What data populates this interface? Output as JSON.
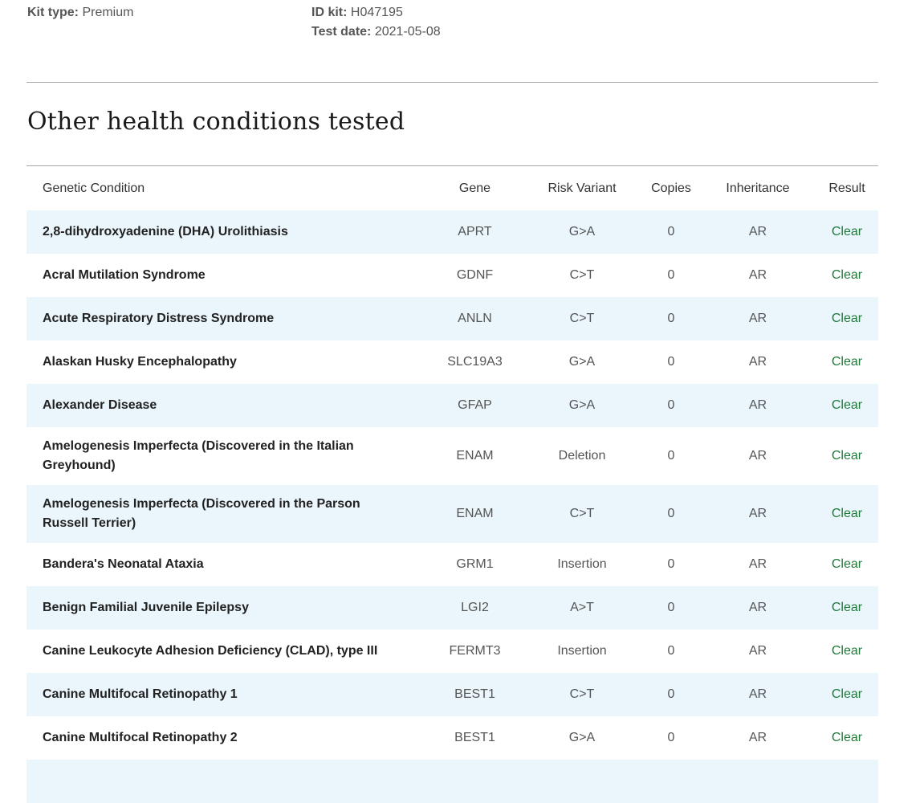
{
  "kit": {
    "type_label": "Kit type:",
    "type_value": "Premium",
    "id_label": "ID kit:",
    "id_value": "H047195",
    "date_label": "Test date:",
    "date_value": "2021-05-08"
  },
  "section": {
    "title": "Other health conditions tested"
  },
  "table": {
    "headers": {
      "condition": "Genetic Condition",
      "gene": "Gene",
      "risk": "Risk Variant",
      "copies": "Copies",
      "inheritance": "Inheritance",
      "result": "Result"
    },
    "rows": [
      {
        "condition": "2,8-dihydroxyadenine (DHA) Urolithiasis",
        "gene": "APRT",
        "risk": "G>A",
        "copies": "0",
        "inheritance": "AR",
        "result": "Clear"
      },
      {
        "condition": "Acral Mutilation Syndrome",
        "gene": "GDNF",
        "risk": "C>T",
        "copies": "0",
        "inheritance": "AR",
        "result": "Clear"
      },
      {
        "condition": "Acute Respiratory Distress Syndrome",
        "gene": "ANLN",
        "risk": "C>T",
        "copies": "0",
        "inheritance": "AR",
        "result": "Clear"
      },
      {
        "condition": "Alaskan Husky Encephalopathy",
        "gene": "SLC19A3",
        "risk": "G>A",
        "copies": "0",
        "inheritance": "AR",
        "result": "Clear"
      },
      {
        "condition": "Alexander Disease",
        "gene": "GFAP",
        "risk": "G>A",
        "copies": "0",
        "inheritance": "AR",
        "result": "Clear"
      },
      {
        "condition": "Amelogenesis Imperfecta (Discovered in the Italian Greyhound)",
        "gene": "ENAM",
        "risk": "Deletion",
        "copies": "0",
        "inheritance": "AR",
        "result": "Clear"
      },
      {
        "condition": "Amelogenesis Imperfecta (Discovered in the Parson Russell Terrier)",
        "gene": "ENAM",
        "risk": "C>T",
        "copies": "0",
        "inheritance": "AR",
        "result": "Clear"
      },
      {
        "condition": "Bandera's Neonatal Ataxia",
        "gene": "GRM1",
        "risk": "Insertion",
        "copies": "0",
        "inheritance": "AR",
        "result": "Clear"
      },
      {
        "condition": "Benign Familial Juvenile Epilepsy",
        "gene": "LGI2",
        "risk": "A>T",
        "copies": "0",
        "inheritance": "AR",
        "result": "Clear"
      },
      {
        "condition": "Canine Leukocyte Adhesion Deficiency (CLAD), type III",
        "gene": "FERMT3",
        "risk": "Insertion",
        "copies": "0",
        "inheritance": "AR",
        "result": "Clear"
      },
      {
        "condition": "Canine Multifocal Retinopathy 1",
        "gene": "BEST1",
        "risk": "C>T",
        "copies": "0",
        "inheritance": "AR",
        "result": "Clear"
      },
      {
        "condition": "Canine Multifocal Retinopathy 2",
        "gene": "BEST1",
        "risk": "G>A",
        "copies": "0",
        "inheritance": "AR",
        "result": "Clear"
      }
    ]
  }
}
